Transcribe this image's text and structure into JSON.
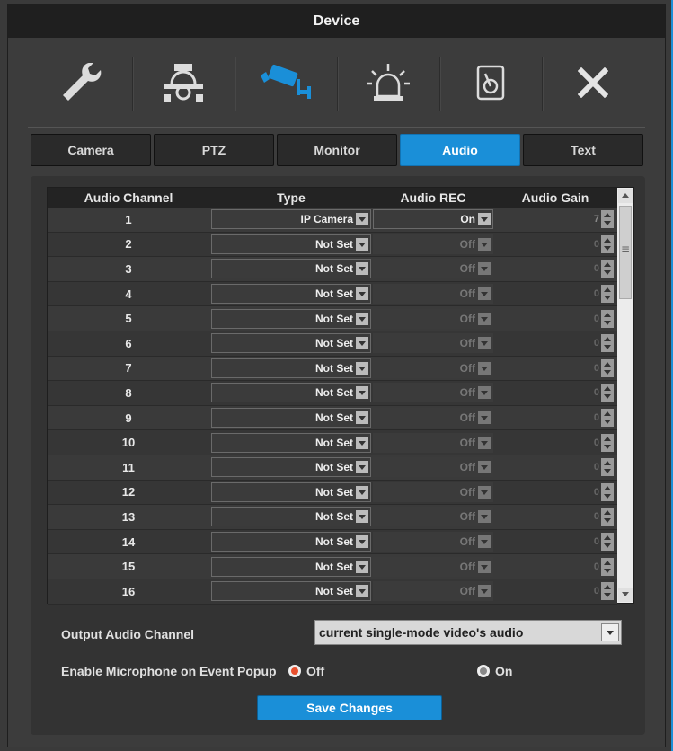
{
  "window": {
    "title": "Device"
  },
  "toolbar": {
    "icons": [
      {
        "name": "wrench-icon"
      },
      {
        "name": "ptz-camera-icon"
      },
      {
        "name": "camera-icon",
        "active": true
      },
      {
        "name": "alarm-light-icon"
      },
      {
        "name": "storage-disk-icon"
      },
      {
        "name": "close-icon"
      }
    ]
  },
  "tabs": [
    {
      "label": "Camera"
    },
    {
      "label": "PTZ"
    },
    {
      "label": "Monitor"
    },
    {
      "label": "Audio",
      "active": true
    },
    {
      "label": "Text"
    }
  ],
  "table": {
    "headers": {
      "channel": "Audio Channel",
      "type": "Type",
      "rec": "Audio REC",
      "gain": "Audio Gain"
    },
    "rows": [
      {
        "channel": "1",
        "type": "IP Camera",
        "rec": "On",
        "gain": "7"
      },
      {
        "channel": "2",
        "type": "Not Set",
        "rec": "Off",
        "gain": "0"
      },
      {
        "channel": "3",
        "type": "Not Set",
        "rec": "Off",
        "gain": "0"
      },
      {
        "channel": "4",
        "type": "Not Set",
        "rec": "Off",
        "gain": "0"
      },
      {
        "channel": "5",
        "type": "Not Set",
        "rec": "Off",
        "gain": "0"
      },
      {
        "channel": "6",
        "type": "Not Set",
        "rec": "Off",
        "gain": "0"
      },
      {
        "channel": "7",
        "type": "Not Set",
        "rec": "Off",
        "gain": "0"
      },
      {
        "channel": "8",
        "type": "Not Set",
        "rec": "Off",
        "gain": "0"
      },
      {
        "channel": "9",
        "type": "Not Set",
        "rec": "Off",
        "gain": "0"
      },
      {
        "channel": "10",
        "type": "Not Set",
        "rec": "Off",
        "gain": "0"
      },
      {
        "channel": "11",
        "type": "Not Set",
        "rec": "Off",
        "gain": "0"
      },
      {
        "channel": "12",
        "type": "Not Set",
        "rec": "Off",
        "gain": "0"
      },
      {
        "channel": "13",
        "type": "Not Set",
        "rec": "Off",
        "gain": "0"
      },
      {
        "channel": "14",
        "type": "Not Set",
        "rec": "Off",
        "gain": "0"
      },
      {
        "channel": "15",
        "type": "Not Set",
        "rec": "Off",
        "gain": "0"
      },
      {
        "channel": "16",
        "type": "Not Set",
        "rec": "Off",
        "gain": "0"
      }
    ]
  },
  "output": {
    "label": "Output Audio Channel",
    "value": "current single-mode video's audio"
  },
  "microphone": {
    "label": "Enable Microphone on Event Popup",
    "off_label": "Off",
    "on_label": "On",
    "selected": "Off"
  },
  "actions": {
    "save_label": "Save Changes"
  },
  "colors": {
    "accent": "#1a8fd8",
    "radio_selected": "#e8502e"
  }
}
